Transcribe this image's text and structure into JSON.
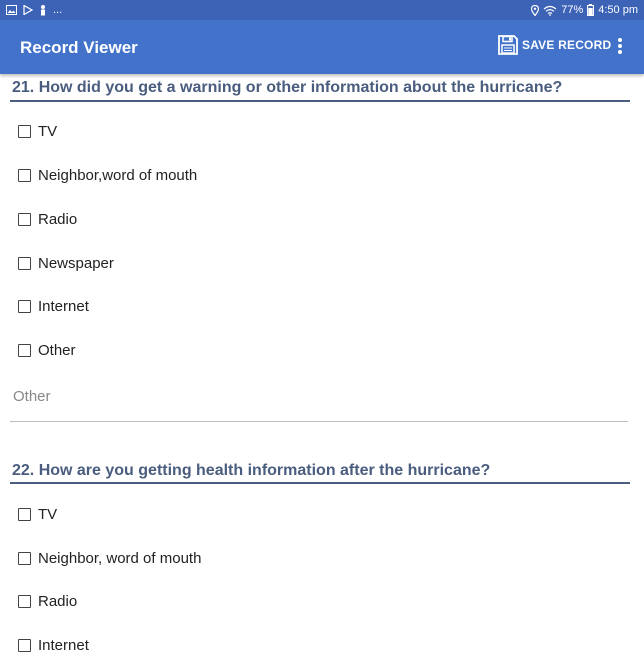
{
  "status_bar": {
    "overflow": "...",
    "battery": "77%",
    "time": "4:50 pm"
  },
  "app_bar": {
    "title": "Record Viewer",
    "save_label": "SAVE RECORD"
  },
  "questions": [
    {
      "title": "21. How did you get a warning or other information about the hurricane?",
      "options": [
        "TV",
        "Neighbor,word of mouth",
        "Radio",
        "Newspaper",
        "Internet",
        "Other"
      ],
      "other_placeholder": "Other"
    },
    {
      "title": "22. How are you getting health information after the hurricane?",
      "options": [
        "TV",
        "Neighbor, word of mouth",
        "Radio",
        "Internet"
      ]
    }
  ],
  "colors": {
    "status_bar": "#3d63b7",
    "app_bar": "#4272c9",
    "question_title": "#4a5d7e"
  }
}
